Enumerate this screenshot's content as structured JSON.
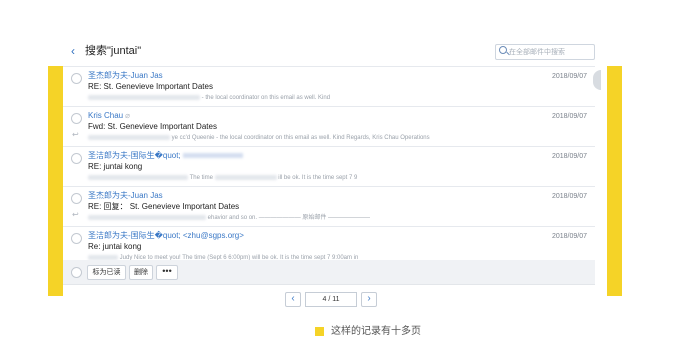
{
  "header": {
    "back_icon": "‹",
    "title": "搜索\"juntai\"",
    "search_placeholder": "在全部邮件中搜索"
  },
  "emails": [
    {
      "sender": "圣杰郎为夫-Juan Jas",
      "date": "2018/09/07",
      "subject": "RE: St. Genevieve Important Dates",
      "preview": "- the local coordinator on this email as well. Kind",
      "has_attachment": false,
      "replied": false
    },
    {
      "sender": "Kris Chau",
      "date": "2018/09/07",
      "subject": "Fwd: St. Genevieve Important Dates",
      "preview": "ye cc'd Queenie - the local coordinator on this email as well. Kind Regards, Kris Chau Operations",
      "has_attachment": true,
      "replied": true
    },
    {
      "sender": "圣洁郎为夫-国际生�quot;",
      "date": "2018/09/07",
      "subject": "RE: juntai kong",
      "preview_a": "The time",
      "preview_b": "ill be ok. It is the time sept 7 9",
      "has_attachment": false,
      "replied": false
    },
    {
      "sender": "圣杰郎为夫-Juan Jas",
      "date": "2018/09/07",
      "subject": "RE: 回复： St. Genevieve Important Dates",
      "preview": "ehavior and so on. ——————— 原始邮件 ———————",
      "has_attachment": false,
      "replied": true
    },
    {
      "sender": "圣洁郎为夫-国际生�quot; <zhu@sgps.org>",
      "date": "2018/09/07",
      "subject": "Re: juntai kong",
      "preview": "Judy Nice to meet you!   The time   (Sept 6 6:00pm)   will be ok. It is the time sept 7 9:00am in",
      "has_attachment": false,
      "replied": false
    }
  ],
  "toolbar": {
    "mark_read": "标为已读",
    "delete": "删除",
    "more": "•••"
  },
  "pager": {
    "prev": "‹",
    "page": "4 / 11",
    "next": "›"
  },
  "caption": "这样的记录有十多页",
  "colors": {
    "accent_yellow": "#f5d327",
    "link_blue": "#3a78c6"
  }
}
